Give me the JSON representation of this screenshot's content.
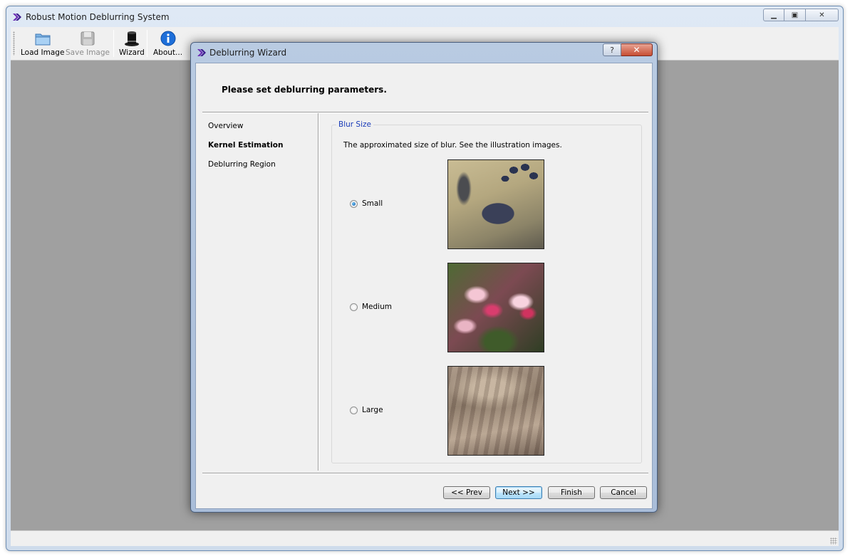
{
  "app": {
    "title": "Robust Motion Deblurring System"
  },
  "toolbar": {
    "items": [
      {
        "label": "Load Image",
        "icon": "folder-icon",
        "enabled": true
      },
      {
        "label": "Save Image",
        "icon": "floppy-disk-icon",
        "enabled": false
      },
      {
        "label": "Wizard",
        "icon": "magic-hat-icon",
        "enabled": true
      },
      {
        "label": "About...",
        "icon": "info-icon",
        "enabled": true
      }
    ]
  },
  "dialog": {
    "title": "Deblurring Wizard",
    "help_label": "?",
    "close_label": "✕",
    "header_title": "Please set deblurring parameters.",
    "steps": [
      {
        "label": "Overview",
        "active": false
      },
      {
        "label": "Kernel Estimation",
        "active": true
      },
      {
        "label": "Deblurring Region",
        "active": false
      }
    ],
    "group": {
      "title": "Blur Size",
      "description": "The approximated size of blur. See the illustration images.",
      "options": [
        {
          "label": "Small",
          "checked": true
        },
        {
          "label": "Medium",
          "checked": false
        },
        {
          "label": "Large",
          "checked": false
        }
      ]
    },
    "buttons": {
      "prev": "<< Prev",
      "next": "Next >>",
      "finish": "Finish",
      "cancel": "Cancel"
    }
  },
  "colors": {
    "accent": "#1a3cb8",
    "workspace": "#a0a0a0",
    "dialog_frame": "#b9cbe2",
    "close_button": "#c74e33"
  }
}
